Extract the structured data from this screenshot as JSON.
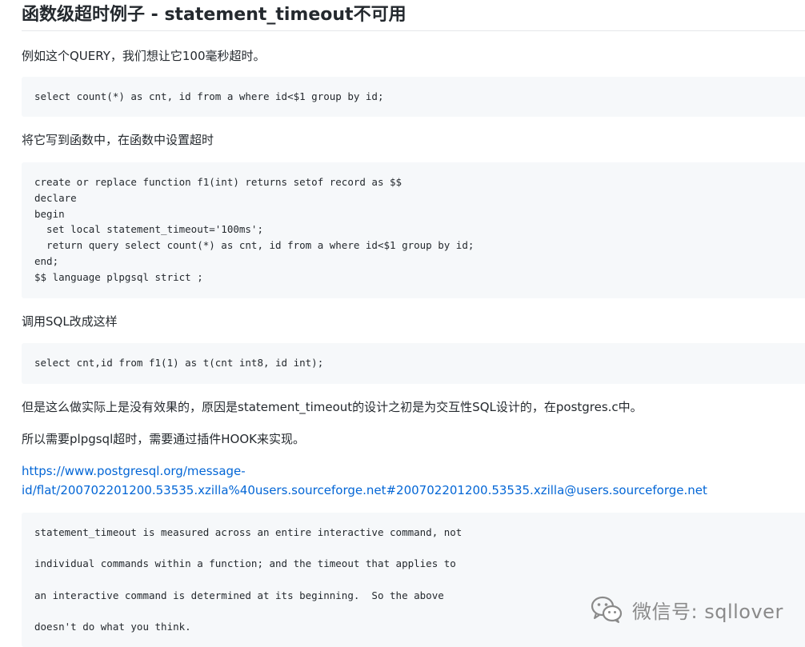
{
  "title": "函数级超时例子 - statement_timeout不可用",
  "intro": "例如这个QUERY，我们想让它100毫秒超时。",
  "code1": [
    "select count(*) as cnt, id from a where id<$1 group by id;"
  ],
  "para2": "将它写到函数中，在函数中设置超时",
  "code2": [
    "create or replace function f1(int) returns setof record as $$",
    "declare",
    "begin",
    "  set local statement_timeout='100ms';",
    "  return query select count(*) as cnt, id from a where id<$1 group by id;",
    "end;",
    "$$ language plpgsql strict ;"
  ],
  "para3": "调用SQL改成这样",
  "code3": [
    "select cnt,id from f1(1) as t(cnt int8, id int);"
  ],
  "para4": "但是这么做实际上是没有效果的，原因是statement_timeout的设计之初是为交互性SQL设计的，在postgres.c中。",
  "para5": "所以需要plpgsql超时，需要通过插件HOOK来实现。",
  "link": {
    "line1": "https://www.postgresql.org/message-",
    "line2": "id/flat/200702201200.53535.xzilla%40users.sourceforge.net#200702201200.53535.xzilla@users.sourceforge.net"
  },
  "code4": [
    "statement_timeout is measured across an entire interactive command, not",
    "individual commands within a function; and the timeout that applies to",
    "an interactive command is determined at its beginning.  So the above",
    "doesn't do what you think."
  ],
  "watermark": {
    "text": "微信号: sqllover",
    "icon": "wechat-icon"
  },
  "colors": {
    "link": "#0366d6",
    "code_bg": "#f6f8fa",
    "text": "#24292e",
    "watermark": "#8a8a8a"
  }
}
